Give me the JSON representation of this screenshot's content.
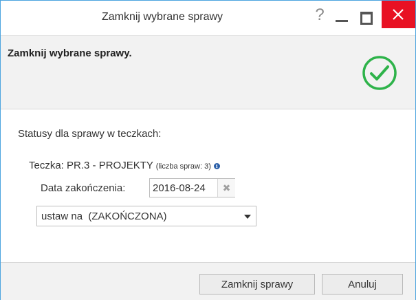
{
  "window": {
    "title": "Zamknij wybrane sprawy",
    "help_glyph": "?",
    "controls": [
      "help-icon",
      "minimize-icon",
      "maximize-icon",
      "close-icon"
    ],
    "close_color": "#e81123"
  },
  "header": {
    "title": "Zamknij wybrane sprawy.",
    "status_icon": "check-circle-icon",
    "accent_color": "#2eb34a"
  },
  "content": {
    "section_label": "Statusy dla sprawy w teczkach:",
    "folder": {
      "label": "Teczka: PR.3 - PROJEKTY",
      "count_text": "(liczba spraw: 3)",
      "info_icon": "info-icon"
    },
    "date": {
      "label": "Data zakończenia:",
      "value": "2016-08-24",
      "clear_glyph": "✖"
    },
    "status_select": {
      "selected": "ustaw na  (ZAKOŃCZONA)"
    }
  },
  "footer": {
    "primary_label": "Zamknij sprawy",
    "cancel_label": "Anuluj"
  }
}
